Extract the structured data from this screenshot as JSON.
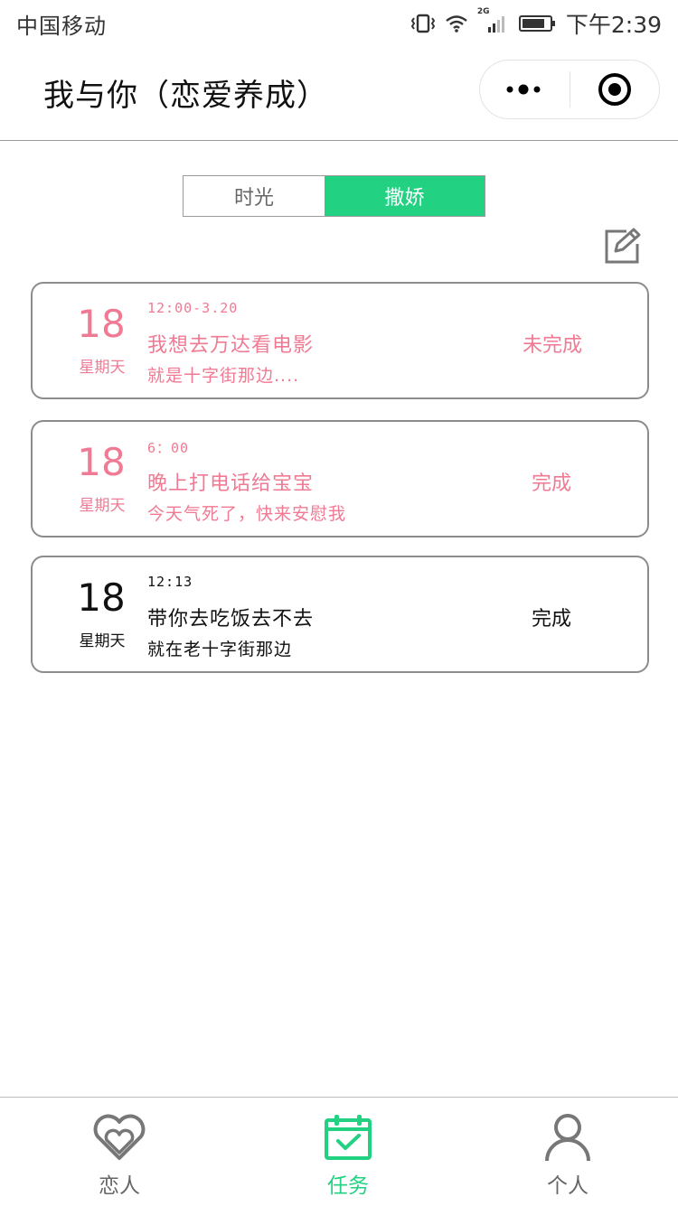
{
  "status_bar": {
    "carrier": "中国移动",
    "network": "2G",
    "time": "下午2:39"
  },
  "nav": {
    "title": "我与你（恋爱养成）"
  },
  "segments": {
    "tab_left": "时光",
    "tab_right": "撒娇",
    "active": "撒娇"
  },
  "tasks": [
    {
      "day": "18",
      "week": "星期天",
      "time": "12:00-3.20",
      "title": "我想去万达看电影",
      "desc": "就是十字街那边....",
      "status": "未完成",
      "color": "#f07a93"
    },
    {
      "day": "18",
      "week": "星期天",
      "time": "6：00",
      "title": "晚上打电话给宝宝",
      "desc": "今天气死了，快来安慰我",
      "status": "完成",
      "color": "#f07a93"
    },
    {
      "day": "18",
      "week": "星期天",
      "time": "12:13",
      "title": "带你去吃饭去不去",
      "desc": "就在老十字街那边",
      "status": "完成",
      "color": "#111111"
    }
  ],
  "tab_bar": {
    "items": [
      {
        "label": "恋人",
        "icon": "heart-icon",
        "active": false
      },
      {
        "label": "任务",
        "icon": "calendar-check-icon",
        "active": true
      },
      {
        "label": "个人",
        "icon": "user-icon",
        "active": false
      }
    ]
  },
  "colors": {
    "accent": "#22d182",
    "pending": "#f07a93",
    "text": "#111111",
    "inactive": "#666666"
  }
}
